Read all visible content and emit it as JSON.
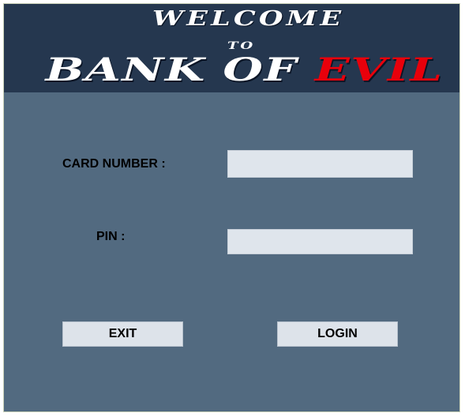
{
  "header": {
    "welcome": "WELCOME",
    "to": "TO",
    "bank_of": "BANK OF",
    "evil": "EVIL",
    "evil_color": "#e8000b",
    "background": "#25374f"
  },
  "form": {
    "background": "#526a80",
    "card_number_label": "CARD NUMBER :",
    "card_number_value": "",
    "pin_label": "PIN :",
    "pin_value": ""
  },
  "buttons": {
    "exit_label": "EXIT",
    "login_label": "LOGIN"
  }
}
